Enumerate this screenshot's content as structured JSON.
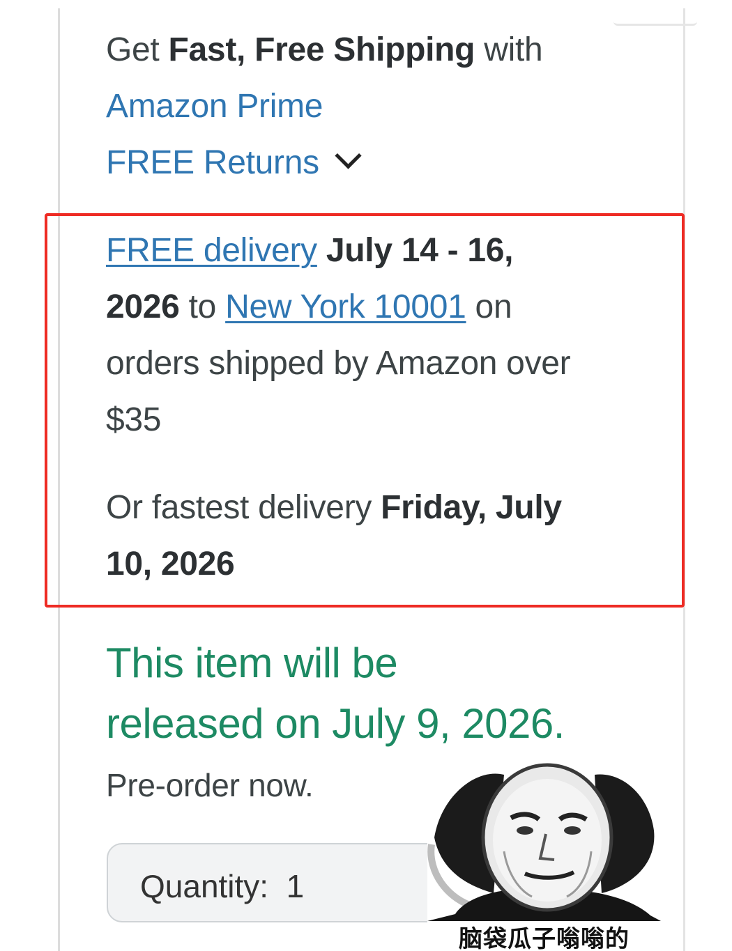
{
  "prime_offer": {
    "prefix": "Get ",
    "bold": "Fast, Free Shipping",
    "suffix": " with",
    "link": "Amazon Prime"
  },
  "returns": {
    "label": "FREE Returns",
    "icon": "chevron-down-icon"
  },
  "delivery": {
    "free_link": "FREE delivery",
    "dates_bold_1": " July 14 - 16,",
    "dates_bold_2": "2026",
    "to": " to ",
    "location_link": "New York 10001",
    "on": " on",
    "line3": "orders shipped by Amazon over",
    "line4": "$35",
    "fastest_prefix": "Or fastest delivery ",
    "fastest_bold_1": "Friday, July",
    "fastest_bold_2": "10, 2026"
  },
  "release": {
    "line1": "This item will be",
    "line2": "released on July 9, 2026.",
    "preorder": "Pre-order now."
  },
  "quantity": {
    "label": "Quantity:",
    "value": "1"
  },
  "meme": {
    "caption": "脑袋瓜子嗡嗡的"
  },
  "colors": {
    "link": "#2f76b2",
    "release_green": "#1d8a63",
    "highlight_red": "#ee2b24"
  }
}
